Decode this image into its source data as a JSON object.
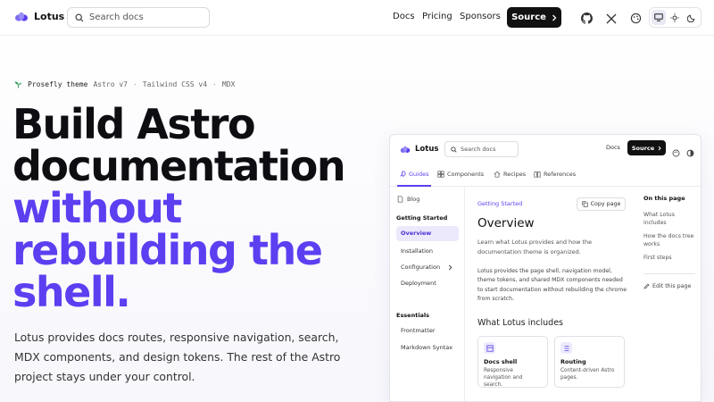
{
  "topbar": {
    "brand": "Lotus",
    "search_placeholder": "Search docs",
    "nav": [
      "Docs",
      "Pricing",
      "Sponsors"
    ],
    "source_label": "Source",
    "icons": [
      "github-icon",
      "x-icon",
      "palette-icon"
    ],
    "theme_options": [
      "system-icon",
      "sun-icon",
      "moon-icon"
    ],
    "theme_active": "system"
  },
  "hero": {
    "theme_name": "Prosefly theme",
    "tech": [
      "Astro v7",
      "Tailwind CSS v4",
      "MDX"
    ],
    "separator": "·",
    "title_line1": "Build Astro",
    "title_line2": "documentation",
    "title_accent1": "without",
    "title_accent2": "rebuilding the",
    "title_accent3": "shell.",
    "description": "Lotus provides docs routes, responsive navigation, search, MDX components, and design tokens. The rest of the Astro project stays under your control."
  },
  "preview": {
    "brand": "Lotus",
    "search_placeholder": "Search docs",
    "docs_link": "Docs",
    "source_label": "Source",
    "tabs": [
      "Guides",
      "Components",
      "Recipes",
      "References"
    ],
    "active_tab": "Guides",
    "sidebar": {
      "blog": "Blog",
      "group1": "Getting Started",
      "items1": [
        "Overview",
        "Installation",
        "Configuration",
        "Deployment"
      ],
      "active_item": "Overview",
      "group2": "Essentials",
      "items2": [
        "Frontmatter",
        "Markdown Syntax"
      ]
    },
    "main": {
      "kicker": "Getting Started",
      "copy_label": "Copy page",
      "title": "Overview",
      "lead": "Learn what Lotus provides and how the documentation theme is organized.",
      "paragraph": "Lotus provides the page shell, navigation model, theme tokens, and shared MDX components needed to start documentation without rebuilding the chrome from scratch.",
      "section_title": "What Lotus includes",
      "cards": [
        {
          "title": "Docs shell",
          "desc": "Responsive navigation and search."
        },
        {
          "title": "Routing",
          "desc": "Content-driven Astro pages."
        }
      ]
    },
    "toc": {
      "title": "On this page",
      "links": [
        "What Lotus includes",
        "How the docs tree works",
        "First steps"
      ],
      "edit_label": "Edit this page"
    }
  },
  "colors": {
    "accent": "#5b3ff0",
    "dark": "#111111",
    "active_bg": "#ebe9fb"
  }
}
